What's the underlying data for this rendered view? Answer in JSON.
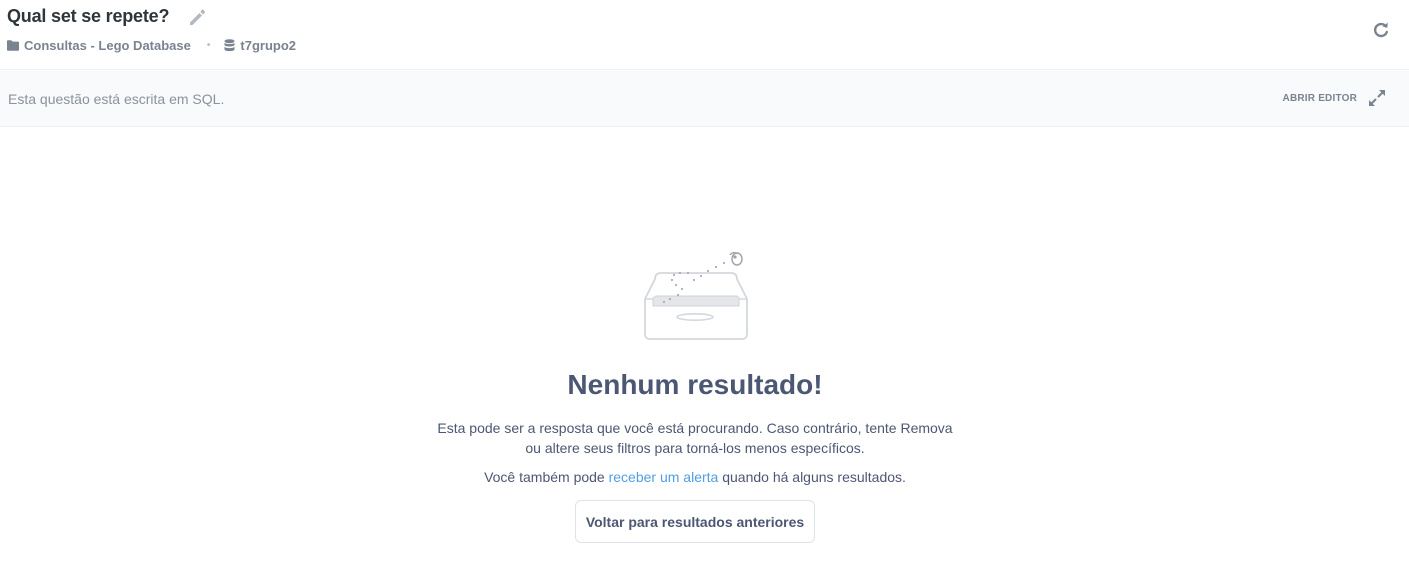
{
  "header": {
    "title": "Qual set se repete?",
    "collection": "Consultas - Lego Database",
    "separator": "•",
    "database": "t7grupo2"
  },
  "icons": {
    "edit": "pencil-icon",
    "collection": "folder-icon",
    "database": "database-icon",
    "refresh": "refresh-icon",
    "expand": "expand-icon",
    "empty": "empty-box-illustration"
  },
  "sql_bar": {
    "note": "Esta questão está escrita em SQL.",
    "open_editor_label": "ABRIR EDITOR"
  },
  "empty_state": {
    "heading": "Nenhum resultado!",
    "description_line1": "Esta pode ser a resposta que você está procurando. Caso contrário, tente Remova",
    "description_line2": "ou altere seus filtros para torná-los menos específicos.",
    "alert_prefix": "Você também pode ",
    "alert_link": "receber um alerta",
    "alert_suffix": " quando há alguns resultados.",
    "back_button": "Voltar para resultados anteriores"
  },
  "colors": {
    "text": "#4c5773",
    "muted": "#7a8390",
    "link": "#509ee3",
    "border": "#eef0f4",
    "bar_bg": "#f9fafb"
  }
}
